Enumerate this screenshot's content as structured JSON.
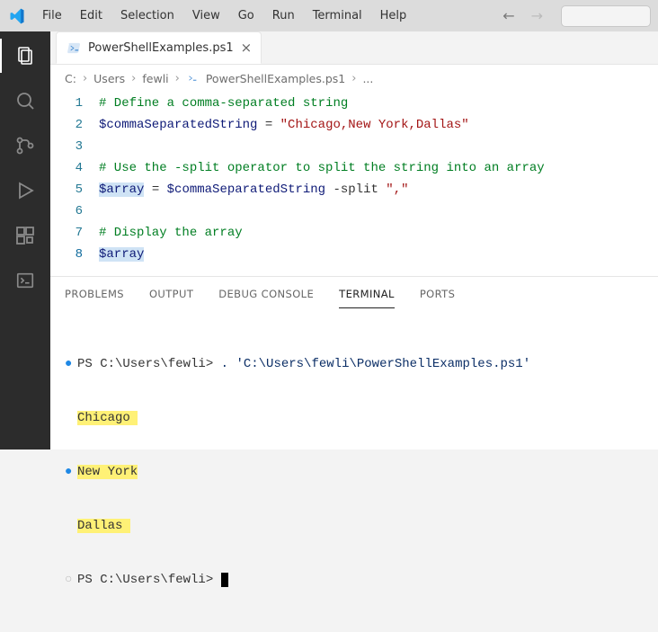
{
  "menu": {
    "file": "File",
    "edit": "Edit",
    "selection": "Selection",
    "view": "View",
    "go": "Go",
    "run": "Run",
    "terminal": "Terminal",
    "help": "Help"
  },
  "tab": {
    "filename": "PowerShellExamples.ps1"
  },
  "breadcrumb": {
    "c": "C:",
    "users": "Users",
    "user": "fewli",
    "file": "PowerShellExamples.ps1",
    "more": "..."
  },
  "code": {
    "lines": [
      "1",
      "2",
      "3",
      "4",
      "5",
      "6",
      "7",
      "8"
    ],
    "l1_comment": "# Define a comma-separated string",
    "l2_var": "$commaSeparatedString",
    "l2_eq": " = ",
    "l2_str": "\"Chicago,New York,Dallas\"",
    "l4_comment": "# Use the -split operator to split the string into an array",
    "l5_var": "$array",
    "l5_eq": " = ",
    "l5_rhsvar": "$commaSeparatedString",
    "l5_split": " -split ",
    "l5_sep": "\",\"",
    "l7_comment": "# Display the array",
    "l8_var": "$array"
  },
  "panel": {
    "problems": "PROBLEMS",
    "output": "OUTPUT",
    "debug": "DEBUG CONSOLE",
    "terminal": "TERMINAL",
    "ports": "PORTS"
  },
  "term": {
    "prompt1_prefix": "PS C:\\Users\\fewli> ",
    "prompt1_cmd": ". 'C:\\Users\\fewli\\PowerShellExamples.ps1'",
    "out1": "Chicago ",
    "out2": "New York",
    "out3": "Dallas ",
    "prompt2": "PS C:\\Users\\fewli> "
  }
}
